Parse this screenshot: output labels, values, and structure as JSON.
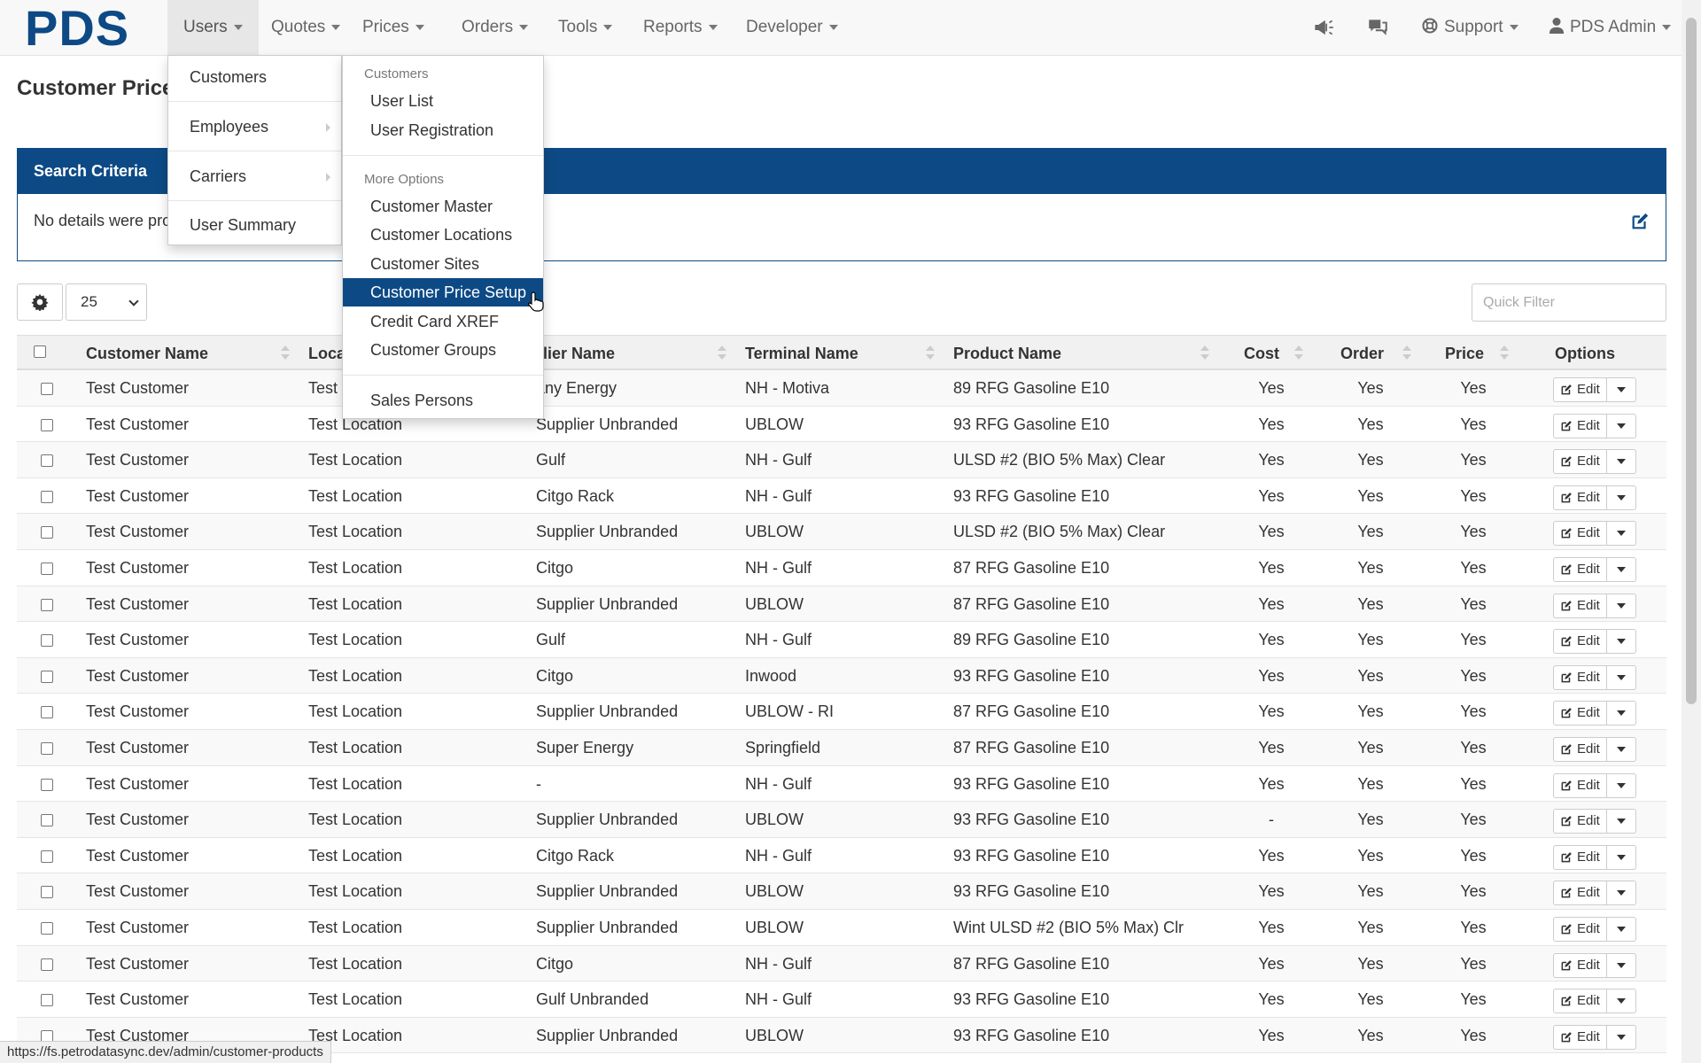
{
  "navbar": {
    "brand": "PDS",
    "menus": [
      "Users",
      "Quotes",
      "Prices",
      "Orders",
      "Tools",
      "Reports",
      "Developer"
    ],
    "support": "Support",
    "user": "PDS Admin"
  },
  "page": {
    "title": "Customer Price",
    "search_panel": {
      "heading": "Search Criteria",
      "body": "No details were pro"
    },
    "page_size": "25",
    "quick_filter_placeholder": "Quick Filter"
  },
  "users_menu": {
    "items": [
      "Customers",
      "Employees",
      "Carriers",
      "User Summary"
    ]
  },
  "customers_submenu": {
    "header_customers": "Customers",
    "user_list": "User List",
    "user_registration": "User Registration",
    "header_more": "More Options",
    "customer_master": "Customer Master",
    "customer_locations": "Customer Locations",
    "customer_sites": "Customer Sites",
    "customer_price_setup": "Customer Price Setup",
    "credit_card_xref": "Credit Card XREF",
    "customer_groups": "Customer Groups",
    "sales_persons": "Sales Persons"
  },
  "table": {
    "headers": {
      "customer_name": "Customer Name",
      "location": "Loca",
      "supplier_name": "pplier Name",
      "terminal_name": "Terminal Name",
      "product_name": "Product Name",
      "cost": "Cost",
      "order": "Order",
      "price": "Price",
      "options": "Options"
    },
    "edit_label": "Edit",
    "rows": [
      {
        "customer": "Test Customer",
        "location": "Test",
        "supplier": "any Energy",
        "terminal": "NH - Motiva",
        "product": "89 RFG Gasoline E10",
        "cost": "Yes",
        "order": "Yes",
        "price": "Yes"
      },
      {
        "customer": "Test Customer",
        "location": "Test Location",
        "supplier": "Supplier Unbranded",
        "terminal": "UBLOW",
        "product": "93 RFG Gasoline E10",
        "cost": "Yes",
        "order": "Yes",
        "price": "Yes"
      },
      {
        "customer": "Test Customer",
        "location": "Test Location",
        "supplier": "Gulf",
        "terminal": "NH - Gulf",
        "product": "ULSD #2 (BIO 5% Max) Clear",
        "cost": "Yes",
        "order": "Yes",
        "price": "Yes"
      },
      {
        "customer": "Test Customer",
        "location": "Test Location",
        "supplier": "Citgo Rack",
        "terminal": "NH - Gulf",
        "product": "93 RFG Gasoline E10",
        "cost": "Yes",
        "order": "Yes",
        "price": "Yes"
      },
      {
        "customer": "Test Customer",
        "location": "Test Location",
        "supplier": "Supplier Unbranded",
        "terminal": "UBLOW",
        "product": "ULSD #2 (BIO 5% Max) Clear",
        "cost": "Yes",
        "order": "Yes",
        "price": "Yes"
      },
      {
        "customer": "Test Customer",
        "location": "Test Location",
        "supplier": "Citgo",
        "terminal": "NH - Gulf",
        "product": "87 RFG Gasoline E10",
        "cost": "Yes",
        "order": "Yes",
        "price": "Yes"
      },
      {
        "customer": "Test Customer",
        "location": "Test Location",
        "supplier": "Supplier Unbranded",
        "terminal": "UBLOW",
        "product": "87 RFG Gasoline E10",
        "cost": "Yes",
        "order": "Yes",
        "price": "Yes"
      },
      {
        "customer": "Test Customer",
        "location": "Test Location",
        "supplier": "Gulf",
        "terminal": "NH - Gulf",
        "product": "89 RFG Gasoline E10",
        "cost": "Yes",
        "order": "Yes",
        "price": "Yes"
      },
      {
        "customer": "Test Customer",
        "location": "Test Location",
        "supplier": "Citgo",
        "terminal": "Inwood",
        "product": "93 RFG Gasoline E10",
        "cost": "Yes",
        "order": "Yes",
        "price": "Yes"
      },
      {
        "customer": "Test Customer",
        "location": "Test Location",
        "supplier": "Supplier Unbranded",
        "terminal": "UBLOW - RI",
        "product": "87 RFG Gasoline E10",
        "cost": "Yes",
        "order": "Yes",
        "price": "Yes"
      },
      {
        "customer": "Test Customer",
        "location": "Test Location",
        "supplier": "Super Energy",
        "terminal": "Springfield",
        "product": "87 RFG Gasoline E10",
        "cost": "Yes",
        "order": "Yes",
        "price": "Yes"
      },
      {
        "customer": "Test Customer",
        "location": "Test Location",
        "supplier": "-",
        "terminal": "NH - Gulf",
        "product": "93 RFG Gasoline E10",
        "cost": "Yes",
        "order": "Yes",
        "price": "Yes"
      },
      {
        "customer": "Test Customer",
        "location": "Test Location",
        "supplier": "Supplier Unbranded",
        "terminal": "UBLOW",
        "product": "93 RFG Gasoline E10",
        "cost": "-",
        "order": "Yes",
        "price": "Yes"
      },
      {
        "customer": "Test Customer",
        "location": "Test Location",
        "supplier": "Citgo Rack",
        "terminal": "NH - Gulf",
        "product": "93 RFG Gasoline E10",
        "cost": "Yes",
        "order": "Yes",
        "price": "Yes"
      },
      {
        "customer": "Test Customer",
        "location": "Test Location",
        "supplier": "Supplier Unbranded",
        "terminal": "UBLOW",
        "product": "93 RFG Gasoline E10",
        "cost": "Yes",
        "order": "Yes",
        "price": "Yes"
      },
      {
        "customer": "Test Customer",
        "location": "Test Location",
        "supplier": "Supplier Unbranded",
        "terminal": "UBLOW",
        "product": "Wint ULSD #2 (BIO 5% Max) Clr",
        "cost": "Yes",
        "order": "Yes",
        "price": "Yes"
      },
      {
        "customer": "Test Customer",
        "location": "Test Location",
        "supplier": "Citgo",
        "terminal": "NH - Gulf",
        "product": "87 RFG Gasoline E10",
        "cost": "Yes",
        "order": "Yes",
        "price": "Yes"
      },
      {
        "customer": "Test Customer",
        "location": "Test Location",
        "supplier": "Gulf Unbranded",
        "terminal": "NH - Gulf",
        "product": "93 RFG Gasoline E10",
        "cost": "Yes",
        "order": "Yes",
        "price": "Yes"
      },
      {
        "customer": "Test Customer",
        "location": "Test Location",
        "supplier": "Supplier Unbranded",
        "terminal": "UBLOW",
        "product": "93 RFG Gasoline E10",
        "cost": "Yes",
        "order": "Yes",
        "price": "Yes"
      }
    ]
  },
  "status_bar": {
    "url": "https://fs.petrodatasync.dev/admin/customer-products"
  },
  "colors": {
    "brand": "#0d4a85",
    "active_item": "#0d4a85"
  }
}
